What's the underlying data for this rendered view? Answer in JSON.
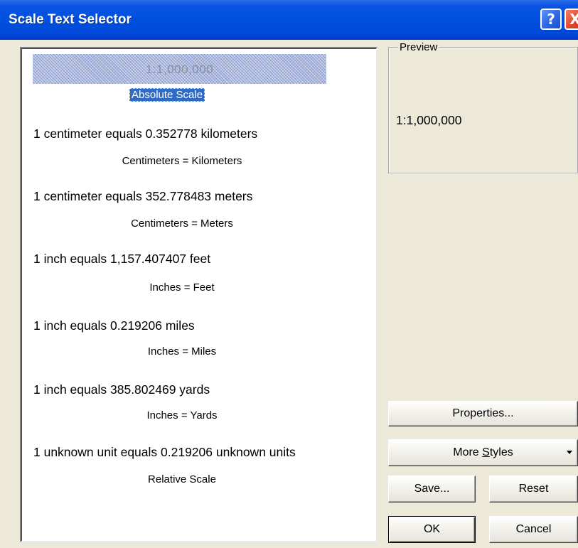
{
  "window": {
    "title": "Scale Text Selector",
    "help_label": "?",
    "close_label": "X"
  },
  "list": {
    "selected_preview_text": "1:1,000,000",
    "selected_label": "Absolute Scale",
    "items": [
      {
        "line": "1 centimeter equals 0.352778 kilometers",
        "sub": "Centimeters = Kilometers"
      },
      {
        "line": "1 centimeter equals 352.778483 meters",
        "sub": "Centimeters = Meters"
      },
      {
        "line": "1 inch equals 1,157.407407 feet",
        "sub": "Inches = Feet"
      },
      {
        "line": "1 inch equals 0.219206 miles",
        "sub": "Inches = Miles"
      },
      {
        "line": "1 inch equals 385.802469 yards",
        "sub": "Inches = Yards"
      },
      {
        "line": "1 unknown unit equals 0.219206 unknown units",
        "sub": "Relative Scale"
      }
    ]
  },
  "preview": {
    "legend": "Preview",
    "value": "1:1,000,000"
  },
  "buttons": {
    "properties": "Properties...",
    "more_styles_pre": "More ",
    "more_styles_mnemonic": "S",
    "more_styles_post": "tyles",
    "save": "Save...",
    "reset": "Reset",
    "ok": "OK",
    "cancel": "Cancel"
  }
}
